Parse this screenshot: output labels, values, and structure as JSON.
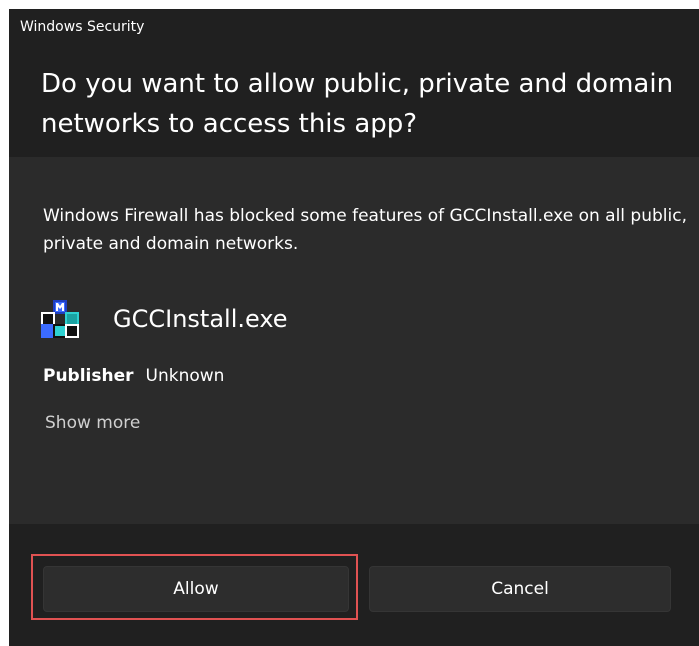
{
  "window": {
    "title": "Windows Security"
  },
  "dialog": {
    "headline": "Do you want to allow public, private and domain networks to access this app?",
    "description": "Windows Firewall has blocked some features of GCCInstall.exe on all public, private and domain networks."
  },
  "app": {
    "name": "GCCInstall.exe",
    "icon": "mfc-app-icon",
    "publisher_label": "Publisher",
    "publisher_value": "Unknown",
    "show_more_label": "Show more"
  },
  "buttons": {
    "allow_label": "Allow",
    "cancel_label": "Cancel"
  },
  "colors": {
    "dialog_background": "#2b2b2b",
    "header_background": "#202020",
    "button_background": "#2d2d2d",
    "highlight_border": "#e05252"
  }
}
